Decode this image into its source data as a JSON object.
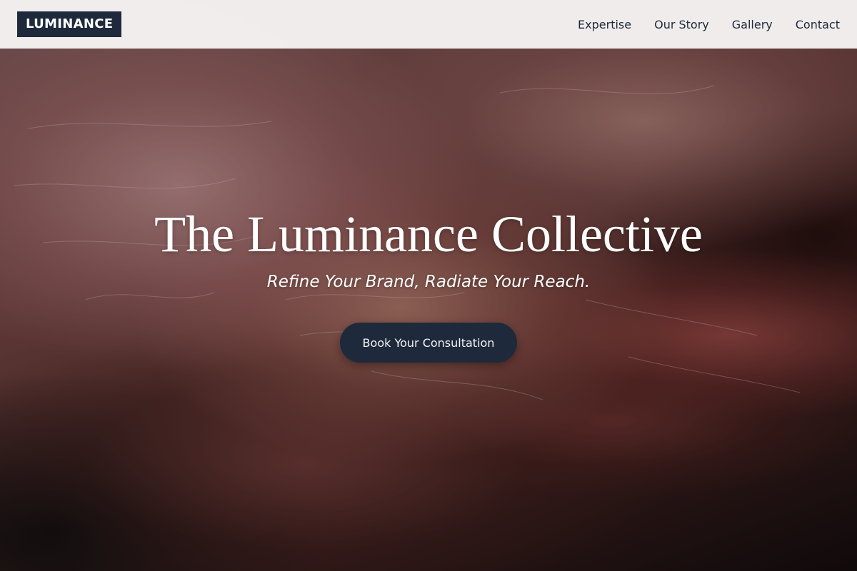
{
  "header": {
    "logo": "LUMINANCE",
    "nav": [
      {
        "label": "Expertise"
      },
      {
        "label": "Our Story"
      },
      {
        "label": "Gallery"
      },
      {
        "label": "Contact"
      }
    ]
  },
  "hero": {
    "title": "The Luminance Collective",
    "subtitle": "Refine Your Brand, Radiate Your Reach.",
    "cta_label": "Book Your Consultation",
    "background_image": "close-up-hands-palm-photo"
  },
  "colors": {
    "brand_navy": "#1e293b",
    "header_bg": "#f6f4f3",
    "hero_text": "#ffffff"
  }
}
